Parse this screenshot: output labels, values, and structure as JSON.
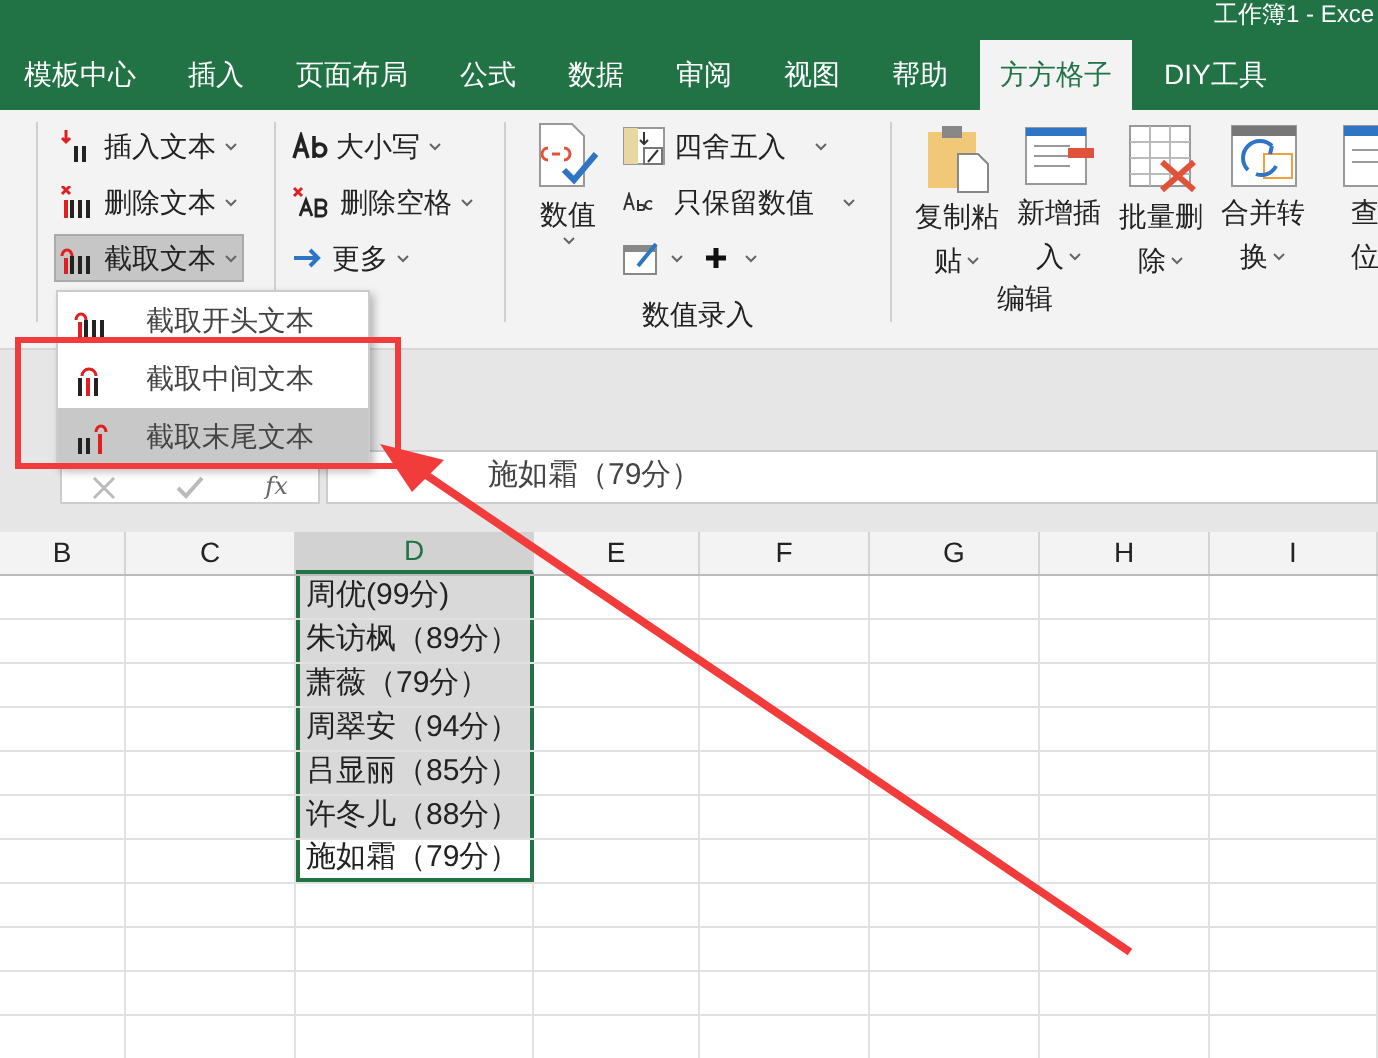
{
  "window": {
    "title": "工作簿1 - Exce"
  },
  "tabs": [
    {
      "label": "模板中心",
      "selected": false
    },
    {
      "label": "插入",
      "selected": false
    },
    {
      "label": "页面布局",
      "selected": false
    },
    {
      "label": "公式",
      "selected": false
    },
    {
      "label": "数据",
      "selected": false
    },
    {
      "label": "审阅",
      "selected": false
    },
    {
      "label": "视图",
      "selected": false
    },
    {
      "label": "帮助",
      "selected": false
    },
    {
      "label": "方方格子",
      "selected": true
    },
    {
      "label": "DIY工具",
      "selected": false
    }
  ],
  "ribbon": {
    "text_group": [
      {
        "kind": "insert",
        "label": "插入文本",
        "pressed": false
      },
      {
        "kind": "delete",
        "label": "删除文本",
        "pressed": false
      },
      {
        "kind": "extract",
        "label": "截取文本",
        "pressed": true
      }
    ],
    "case_group": [
      {
        "kind": "case",
        "label": "大小写"
      },
      {
        "kind": "space",
        "label": "删除空格"
      },
      {
        "kind": "more",
        "label": "更多"
      }
    ],
    "number_group": {
      "label": "数值录入",
      "big_button": "数值",
      "items": [
        {
          "kind": "round",
          "label": "四舍五入"
        },
        {
          "kind": "keep",
          "label": "只保留数值"
        }
      ]
    },
    "edit_group": {
      "label": "编辑",
      "buttons": [
        {
          "kind": "paste",
          "lines": [
            "复制粘",
            "贴"
          ]
        },
        {
          "kind": "insert",
          "lines": [
            "新增插",
            "入"
          ]
        },
        {
          "kind": "delete",
          "lines": [
            "批量删",
            "除"
          ]
        },
        {
          "kind": "merge",
          "lines": [
            "合并转",
            "换"
          ]
        },
        {
          "kind": "find",
          "lines": [
            "查",
            "位"
          ]
        }
      ]
    }
  },
  "dropdown_menu": [
    {
      "kind": "head",
      "label": "截取开头文本",
      "selected": false
    },
    {
      "kind": "middle",
      "label": "截取中间文本",
      "selected": false
    },
    {
      "kind": "tail",
      "label": "截取末尾文本",
      "selected": true
    }
  ],
  "formula_bar": {
    "function_label": "fx",
    "value": "施如霜（79分）"
  },
  "columns": [
    {
      "label": "B",
      "selected": false
    },
    {
      "label": "C",
      "selected": false
    },
    {
      "label": "D",
      "selected": true
    },
    {
      "label": "E",
      "selected": false
    },
    {
      "label": "F",
      "selected": false
    },
    {
      "label": "G",
      "selected": false
    },
    {
      "label": "H",
      "selected": false
    },
    {
      "label": "I",
      "selected": false
    }
  ],
  "cells": [
    {
      "value": "周优(99分)",
      "active": false
    },
    {
      "value": "朱访枫（89分）",
      "active": false
    },
    {
      "value": "萧薇（79分）",
      "active": false
    },
    {
      "value": "周翠安（94分）",
      "active": false
    },
    {
      "value": "吕显丽（85分）",
      "active": false
    },
    {
      "value": "许冬儿（88分）",
      "active": false
    },
    {
      "value": "施如霜（79分）",
      "active": true
    }
  ]
}
